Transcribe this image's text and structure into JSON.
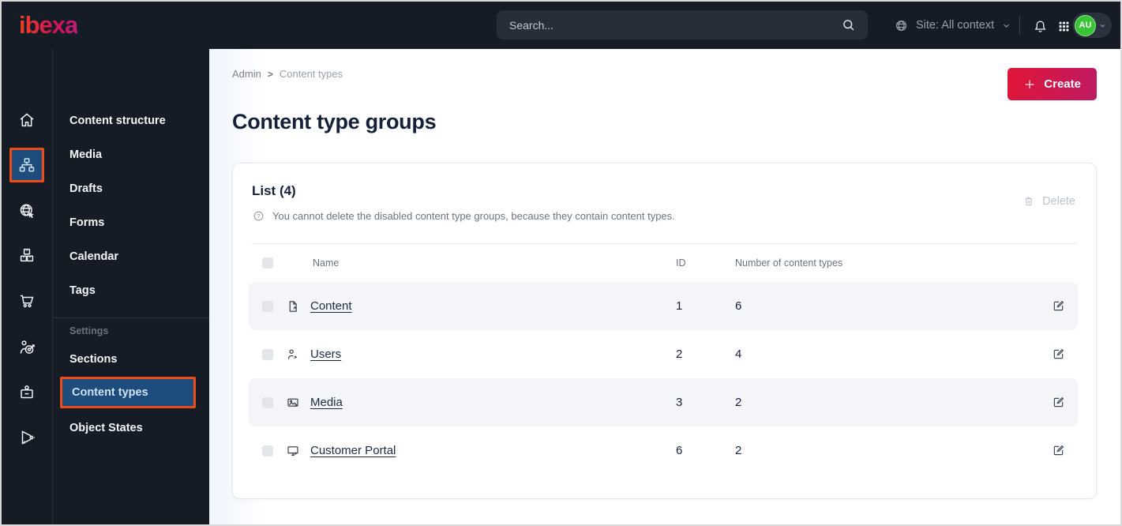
{
  "topbar": {
    "logo_text": "ibexa",
    "search_placeholder": "Search...",
    "site_context_label": "Site: All context",
    "avatar_initials": "AU",
    "icons": [
      "search-icon",
      "site-globe-icon",
      "notifications-bell-icon",
      "app-grid-icon",
      "chevron-down-icon"
    ]
  },
  "sidebar": {
    "rail_icons": [
      "home-icon",
      "content-structure-icon",
      "site-icon",
      "product-catalog-icon",
      "commerce-cart-icon",
      "personalization-icon",
      "customer-portal-badge-icon",
      "marketing-megaphone-icon"
    ],
    "rail_active": "content-structure-icon",
    "menu_items": [
      "Content structure",
      "Media",
      "Drafts",
      "Forms",
      "Calendar",
      "Tags"
    ],
    "settings_label": "Settings",
    "settings_items": [
      "Sections",
      "Content types",
      "Object States"
    ],
    "active_item": "Content types"
  },
  "main": {
    "breadcrumb": {
      "items": [
        "Admin",
        "Content types"
      ],
      "separator": ">"
    },
    "create_button_label": "Create",
    "page_title": "Content type groups",
    "card": {
      "list_title": "List (4)",
      "help_text": "You cannot delete the disabled content type groups, because they contain content types.",
      "delete_button_label": "Delete",
      "table": {
        "columns": [
          "Name",
          "ID",
          "Number of content types"
        ],
        "rows": [
          {
            "icon": "content-file-icon",
            "name": "Content",
            "id": "1",
            "count": "6"
          },
          {
            "icon": "users-person-icon",
            "name": "Users",
            "id": "2",
            "count": "4"
          },
          {
            "icon": "media-image-icon",
            "name": "Media",
            "id": "3",
            "count": "2"
          },
          {
            "icon": "customer-portal-monitor-icon",
            "name": "Customer Portal",
            "id": "6",
            "count": "2"
          }
        ]
      }
    }
  },
  "colors": {
    "topbar_bg": "#151c26",
    "sidebar_bg": "#151c26",
    "highlight_orange": "#f04a17",
    "selected_blue": "#1e4d7d",
    "brand_gradient_start": "#e01638",
    "brand_gradient_end": "#bf1a63",
    "avatar_green": "#36c636",
    "link_color": "#1a2b44",
    "row_stripe": "#f4f5f8"
  }
}
